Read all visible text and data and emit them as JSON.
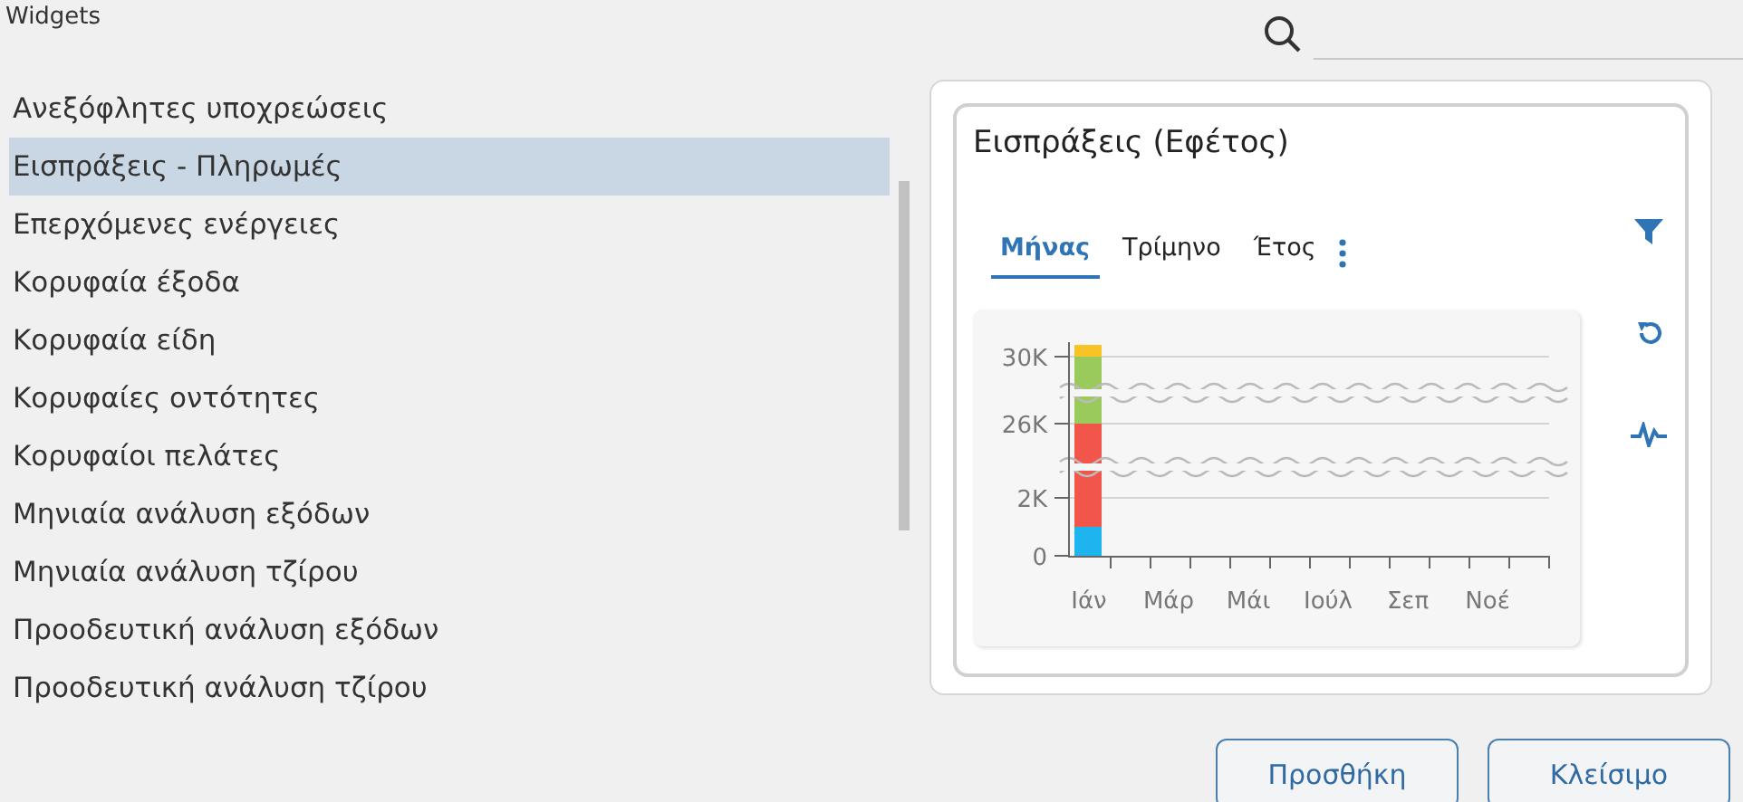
{
  "window": {
    "title": "Widgets"
  },
  "widgets": [
    {
      "label": "Ανεξόφλητες υποχρεώσεις",
      "selected": false
    },
    {
      "label": "Εισπράξεις - Πληρωμές",
      "selected": true
    },
    {
      "label": "Επερχόμενες ενέργειες",
      "selected": false
    },
    {
      "label": "Κορυφαία έξοδα",
      "selected": false
    },
    {
      "label": "Κορυφαία είδη",
      "selected": false
    },
    {
      "label": "Κορυφαίες οντότητες",
      "selected": false
    },
    {
      "label": "Κορυφαίοι πελάτες",
      "selected": false
    },
    {
      "label": "Μηνιαία ανάλυση εξόδων",
      "selected": false
    },
    {
      "label": "Μηνιαία ανάλυση τζίρου",
      "selected": false
    },
    {
      "label": "Προοδευτική ανάλυση εξόδων",
      "selected": false
    },
    {
      "label": "Προοδευτική ανάλυση τζίρου",
      "selected": false
    }
  ],
  "preview": {
    "title": "Εισπράξεις (Εφέτος)",
    "tabs": [
      {
        "label": "Μήνας",
        "selected": true
      },
      {
        "label": "Τρίμηνο",
        "selected": false
      },
      {
        "label": "Έτος",
        "selected": false
      }
    ],
    "chart": {
      "x_labels": [
        "Ιάν",
        "Μάρ",
        "Μάι",
        "Ιούλ",
        "Σεπ",
        "Νοέ"
      ],
      "y_labels": [
        "30K",
        "26K",
        "2K",
        "0"
      ]
    }
  },
  "buttons": [
    {
      "label": "Προσθήκη"
    },
    {
      "label": "Κλείσιμο"
    }
  ]
}
